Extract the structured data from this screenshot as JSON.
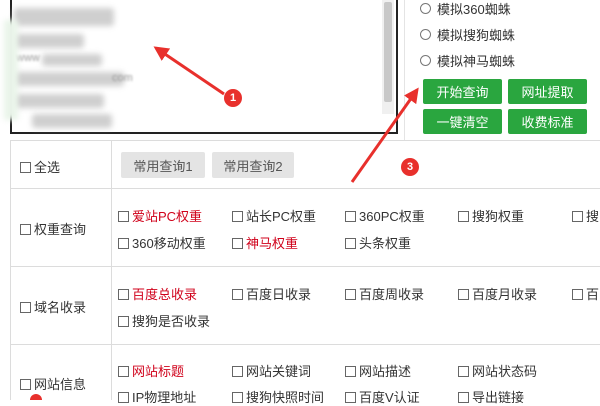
{
  "textarea": {
    "blurred_lines": [
      {
        "text": "www"
      },
      {
        "text": "com"
      }
    ]
  },
  "engines": [
    {
      "label": "模拟360蜘蛛"
    },
    {
      "label": "模拟搜狗蜘蛛"
    },
    {
      "label": "模拟神马蜘蛛"
    }
  ],
  "actions": {
    "start_query": "开始查询",
    "url_extract": "网址提取",
    "clear_all": "一键清空",
    "pricing": "收费标准"
  },
  "badges": [
    "1",
    "3"
  ],
  "select_all": "全选",
  "common_query_1": "常用查询1",
  "common_query_2": "常用查询2",
  "weight": {
    "label": "权重查询",
    "items": [
      {
        "text": "爱站PC权重",
        "red": true
      },
      {
        "text": "站长PC权重",
        "red": false
      },
      {
        "text": "360PC权重",
        "red": false
      },
      {
        "text": "搜狗权重",
        "red": false
      },
      {
        "text": "搜",
        "red": false
      },
      {
        "text": "360移动权重",
        "red": false
      },
      {
        "text": "神马权重",
        "red": true
      },
      {
        "text": "头条权重",
        "red": false
      }
    ]
  },
  "index": {
    "label": "域名收录",
    "items": [
      {
        "text": "百度总收录",
        "red": true
      },
      {
        "text": "百度日收录",
        "red": false
      },
      {
        "text": "百度周收录",
        "red": false
      },
      {
        "text": "百度月收录",
        "red": false
      },
      {
        "text": "百",
        "red": false
      },
      {
        "text": "搜狗是否收录",
        "red": false
      }
    ]
  },
  "site_info": {
    "label": "网站信息",
    "items": [
      {
        "text": "网站标题",
        "red": true
      },
      {
        "text": "网站关键词",
        "red": false
      },
      {
        "text": "网站描述",
        "red": false
      },
      {
        "text": "网站状态码",
        "red": false
      },
      {
        "text": "IP物理地址",
        "red": false
      },
      {
        "text": "搜狗快照时间",
        "red": false
      },
      {
        "text": "百度V认证",
        "red": false
      },
      {
        "text": "导出链接",
        "red": false
      }
    ]
  }
}
